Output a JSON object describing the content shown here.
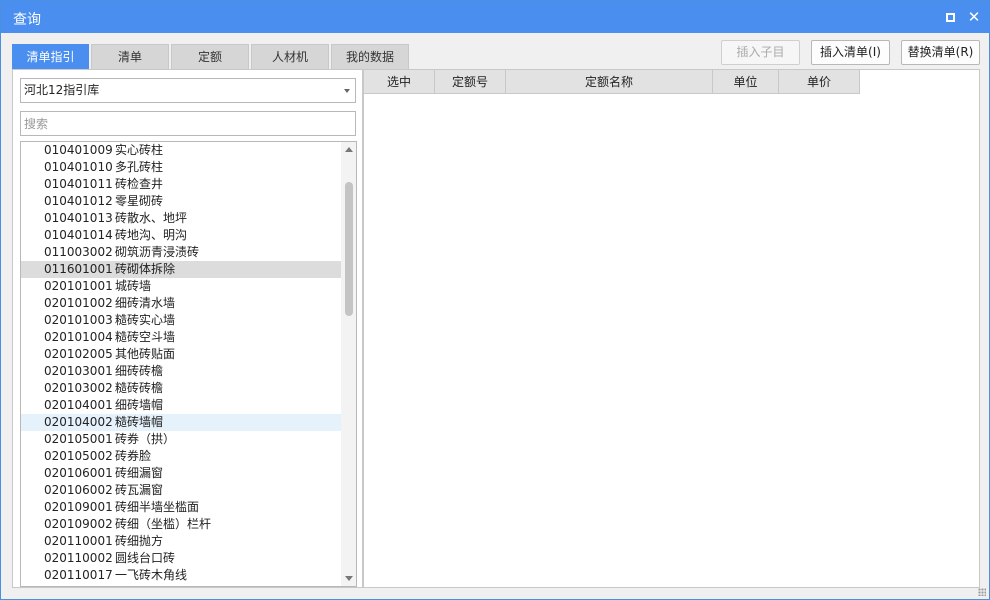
{
  "window": {
    "title": "查询",
    "maximize_icon": "maximize-icon",
    "close_icon": "close-icon"
  },
  "tabs": [
    {
      "label": "清单指引",
      "active": true
    },
    {
      "label": "清单",
      "active": false
    },
    {
      "label": "定额",
      "active": false
    },
    {
      "label": "人材机",
      "active": false
    },
    {
      "label": "我的数据",
      "active": false
    }
  ],
  "toolbar": {
    "insert_child_label": "插入子目",
    "insert_list_label": "插入清单(I)",
    "replace_list_label": "替换清单(R)"
  },
  "left": {
    "library_select": "河北12指引库",
    "search_placeholder": "搜索",
    "items": [
      {
        "code": "010401009",
        "name": "实心砖柱"
      },
      {
        "code": "010401010",
        "name": "多孔砖柱"
      },
      {
        "code": "010401011",
        "name": "砖检查井"
      },
      {
        "code": "010401012",
        "name": "零星砌砖"
      },
      {
        "code": "010401013",
        "name": "砖散水、地坪"
      },
      {
        "code": "010401014",
        "name": "砖地沟、明沟"
      },
      {
        "code": "011003002",
        "name": "砌筑沥青浸渍砖"
      },
      {
        "code": "011601001",
        "name": "砖砌体拆除"
      },
      {
        "code": "020101001",
        "name": "城砖墙"
      },
      {
        "code": "020101002",
        "name": "细砖清水墙"
      },
      {
        "code": "020101003",
        "name": "糙砖实心墙"
      },
      {
        "code": "020101004",
        "name": "糙砖空斗墙"
      },
      {
        "code": "020102005",
        "name": "其他砖贴面"
      },
      {
        "code": "020103001",
        "name": "细砖砖檐"
      },
      {
        "code": "020103002",
        "name": "糙砖砖檐"
      },
      {
        "code": "020104001",
        "name": "细砖墙帽"
      },
      {
        "code": "020104002",
        "name": "糙砖墙帽"
      },
      {
        "code": "020105001",
        "name": "砖券（拱）"
      },
      {
        "code": "020105002",
        "name": "砖券脸"
      },
      {
        "code": "020106001",
        "name": "砖细漏窗"
      },
      {
        "code": "020106002",
        "name": "砖瓦漏窗"
      },
      {
        "code": "020109001",
        "name": "砖细半墙坐槛面"
      },
      {
        "code": "020109002",
        "name": "砖细（坐槛）栏杆"
      },
      {
        "code": "020110001",
        "name": "砖细抛方"
      },
      {
        "code": "020110002",
        "name": "圆线台口砖"
      },
      {
        "code": "020110017",
        "name": "一飞砖木角线"
      }
    ],
    "selected_index": 7,
    "hover_index": 16
  },
  "grid": {
    "columns": [
      "选中",
      "定额号",
      "定额名称",
      "单位",
      "单价"
    ]
  }
}
